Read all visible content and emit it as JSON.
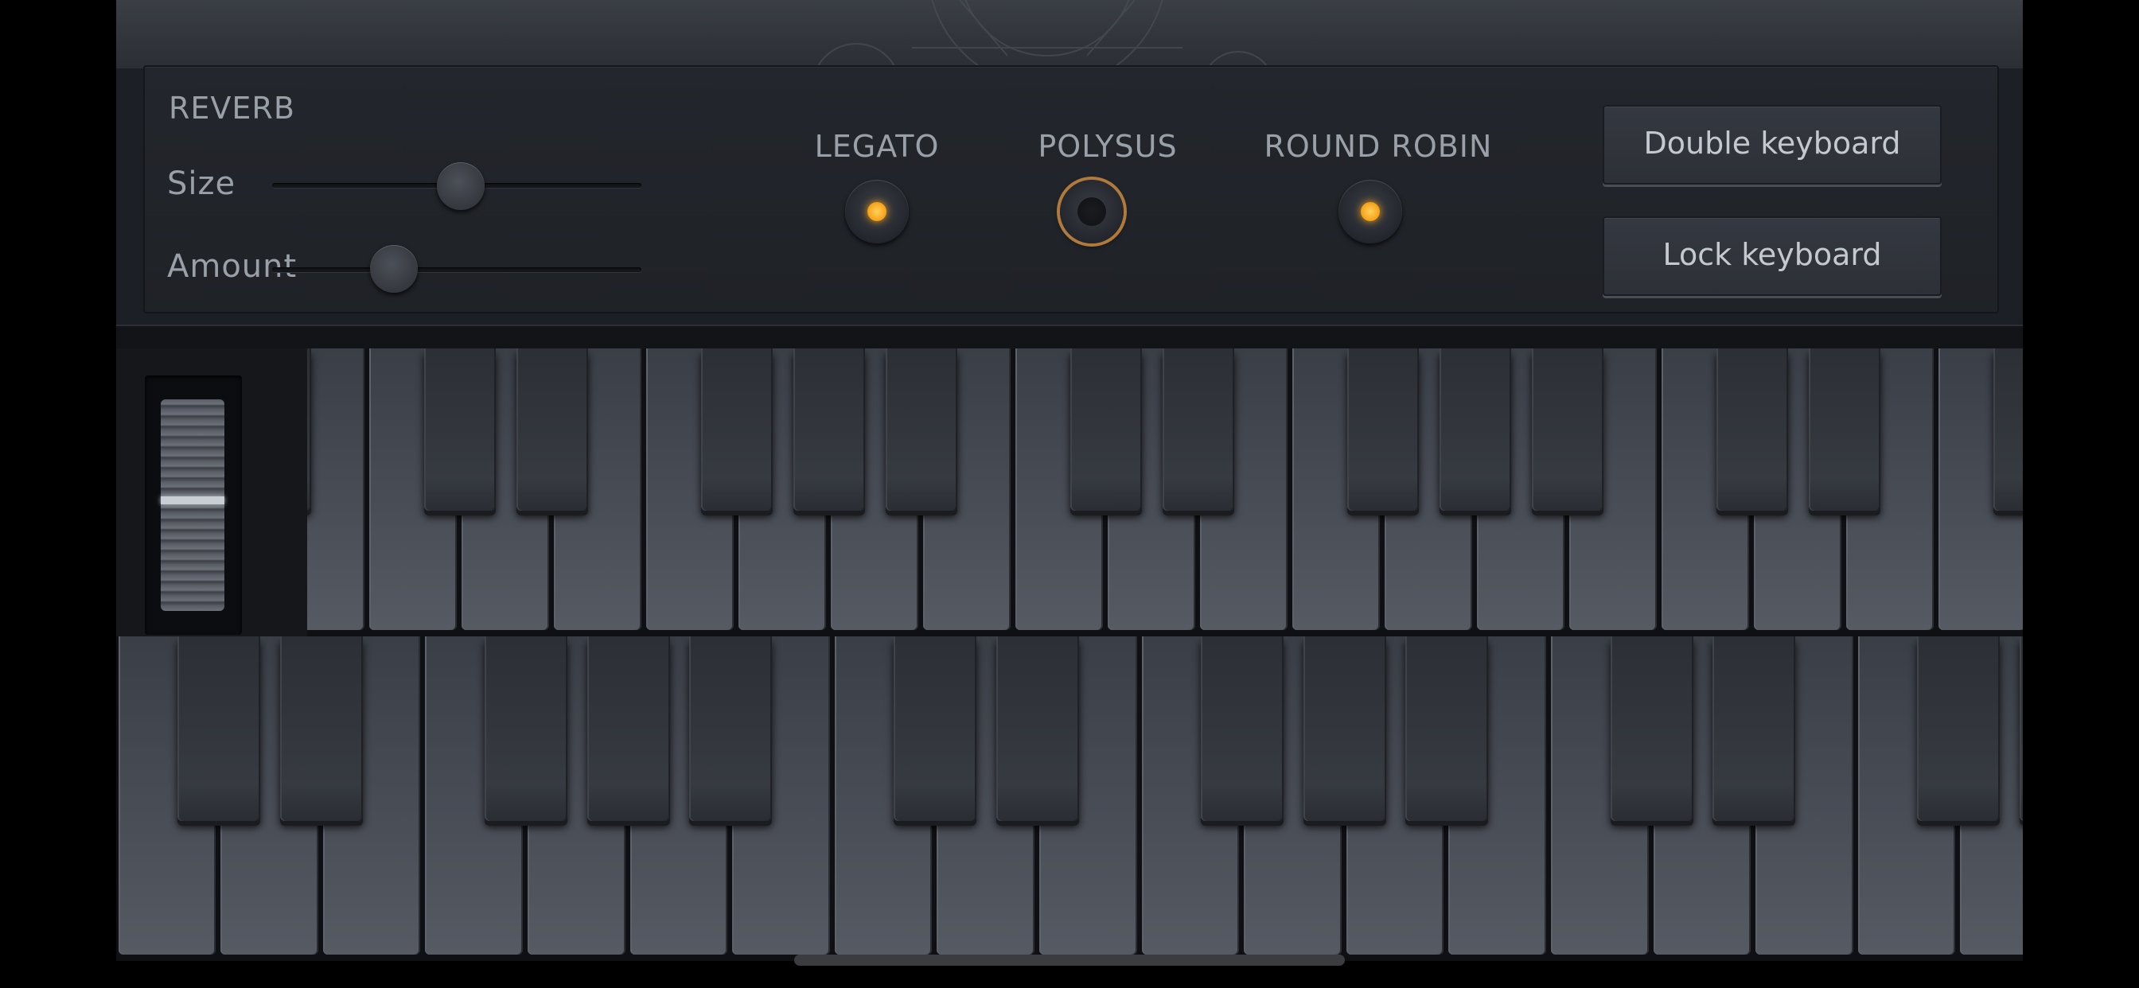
{
  "reverb": {
    "title": "REVERB",
    "size_label": "Size",
    "size_value": 0.51,
    "amount_label": "Amount",
    "amount_value": 0.33
  },
  "toggles": [
    {
      "label": "LEGATO",
      "state": "on"
    },
    {
      "label": "POLYSUS",
      "state": "off"
    },
    {
      "label": "ROUND ROBIN",
      "state": "on"
    }
  ],
  "buttons": {
    "double_keyboard": "Double keyboard",
    "lock_keyboard": "Lock keyboard"
  },
  "colors": {
    "led_on": "#f5a016",
    "led_off_ring": "#b07a3c"
  },
  "icons": {
    "mod_wheel": "pitch-mod-wheel"
  }
}
